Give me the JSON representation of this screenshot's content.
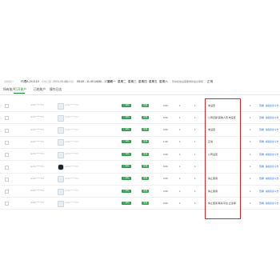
{
  "info_bar": {
    "account_label": "当前账户",
    "account_value": "代理A,24.5.19",
    "date_label": "有效日期",
    "date_value": "2024-05-16",
    "time_label": "投放时段",
    "time_value": "09:00 - 11:40 14:30 - 17:00",
    "days_label": "投放日",
    "days": [
      "星期一",
      "星期二",
      "星期三",
      "星期四",
      "星期五",
      "星期六"
    ],
    "action_link": "暂停投放后需要重新提交审核",
    "status_text": "正常"
  },
  "tabs": [
    {
      "label": "所有账户",
      "active": false
    },
    {
      "label": "已开账户",
      "active": true
    },
    {
      "label": "已结账户",
      "active": false
    },
    {
      "label": "操作日志",
      "active": false
    }
  ],
  "rows": [
    {
      "name": "sidN7*****P1",
      "pill_a": "已审核",
      "pill_b": "生效",
      "score": "0.60",
      "count": "1",
      "amount": "1",
      "note": "未设置",
      "actions": [
        "查看",
        "编辑备注/平台"
      ]
    },
    {
      "name": "sidN7*****P1",
      "pill_a": "已审核",
      "pill_b": "生效",
      "score": "0.60",
      "count": "1",
      "amount": "1",
      "note": "公司定额:其他人员:未设置",
      "actions": [
        "查看",
        "编辑备注/平台"
      ]
    },
    {
      "name": "sidN7*****P1",
      "pill_a": "已审核",
      "pill_b": "生效",
      "score": "0.60",
      "count": "1",
      "amount": "1",
      "note": "未设置",
      "actions": [
        "查看",
        "编辑备注/平台"
      ]
    },
    {
      "name": "sidN7*****P1",
      "pill_a": "已审核",
      "pill_b": "生效",
      "score": "1.00",
      "count": "1",
      "amount": "1",
      "note": "正常",
      "actions": [
        "查看",
        "编辑备注/平台"
      ]
    },
    {
      "name": "sidN7*****P1",
      "pill_a": "已审核",
      "pill_b": "生效",
      "score": "0.60",
      "count": "1",
      "amount": "1",
      "note": "公司设置",
      "actions": [
        "查看",
        "编辑备注/平台"
      ]
    },
    {
      "name": "sidN7*****P1",
      "pill_a": "已审核",
      "pill_b": "生效",
      "score": "0.60",
      "count": "1",
      "amount": "1",
      "note": "",
      "actions": [
        "查看",
        "编辑备注/平台"
      ]
    },
    {
      "name": "sidN7*****P1",
      "pill_a": "已审核",
      "pill_b": "生效",
      "score": "0.60",
      "count": "1",
      "amount": "1",
      "note": "停止使用",
      "actions": [
        "查看",
        "编辑备注/平台"
      ]
    },
    {
      "name": "sidN7*****P1",
      "pill_a": "已审核",
      "pill_b": "生效",
      "score": "0.60",
      "count": "1",
      "amount": "1",
      "note": "停止使用",
      "actions": [
        "查看",
        "编辑备注/平台"
      ]
    },
    {
      "name": "sidN7*****P1",
      "pill_a": "已审核",
      "pill_b": "生效",
      "score": "0.60",
      "count": "1",
      "amount": "1",
      "note": "停止使用 联系平台:止注销",
      "actions": [
        "查看",
        "编辑备注/平台"
      ]
    }
  ],
  "colors": {
    "accent": "#1e8c3c",
    "highlight_border": "#d9262b",
    "link": "#2f6fd1"
  }
}
